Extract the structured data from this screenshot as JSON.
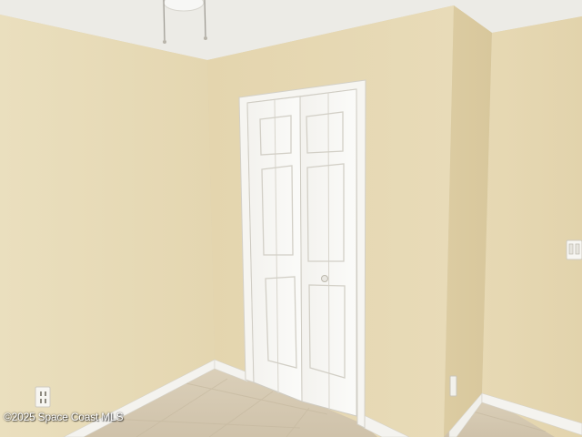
{
  "photo": {
    "subject": "empty-bedroom-with-closet",
    "watermark": "©2025 Space Coast MLS"
  },
  "colors": {
    "wall_left": "#e9dcbb",
    "wall_center": "#e6d8b4",
    "wall_right": "#e3d4ae",
    "ceiling": "#ecebe6",
    "trim": "#f4f3ef",
    "floor": "#d6cab4"
  }
}
